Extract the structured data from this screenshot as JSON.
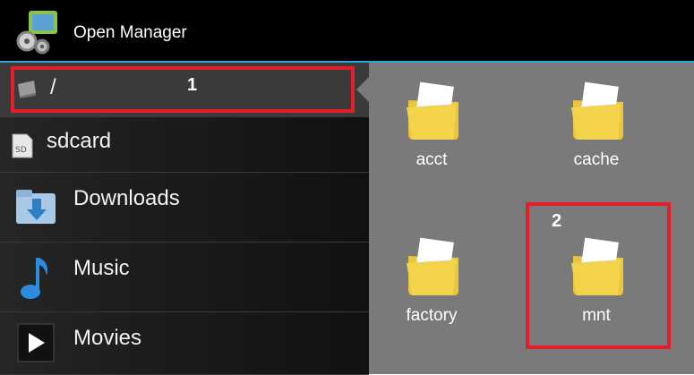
{
  "app": {
    "title": "Open Manager",
    "icon": "android-gear-icon"
  },
  "sidebar": {
    "items": [
      {
        "label": "/",
        "icon": "drive-icon"
      },
      {
        "label": "sdcard",
        "icon": "sd-card-icon"
      },
      {
        "label": "Downloads",
        "icon": "download-folder-icon"
      },
      {
        "label": "Music",
        "icon": "music-note-icon"
      },
      {
        "label": "Movies",
        "icon": "play-icon"
      }
    ]
  },
  "content": {
    "folders": [
      {
        "name": "acct"
      },
      {
        "name": "cache"
      },
      {
        "name": "factory"
      },
      {
        "name": "mnt"
      }
    ]
  },
  "annotations": {
    "box1_label": "1",
    "box2_label": "2",
    "color": "#e41e26"
  },
  "colors": {
    "accent": "#2fa6d8",
    "folder": "#f3d34a",
    "panel": "#7a7a7a"
  }
}
